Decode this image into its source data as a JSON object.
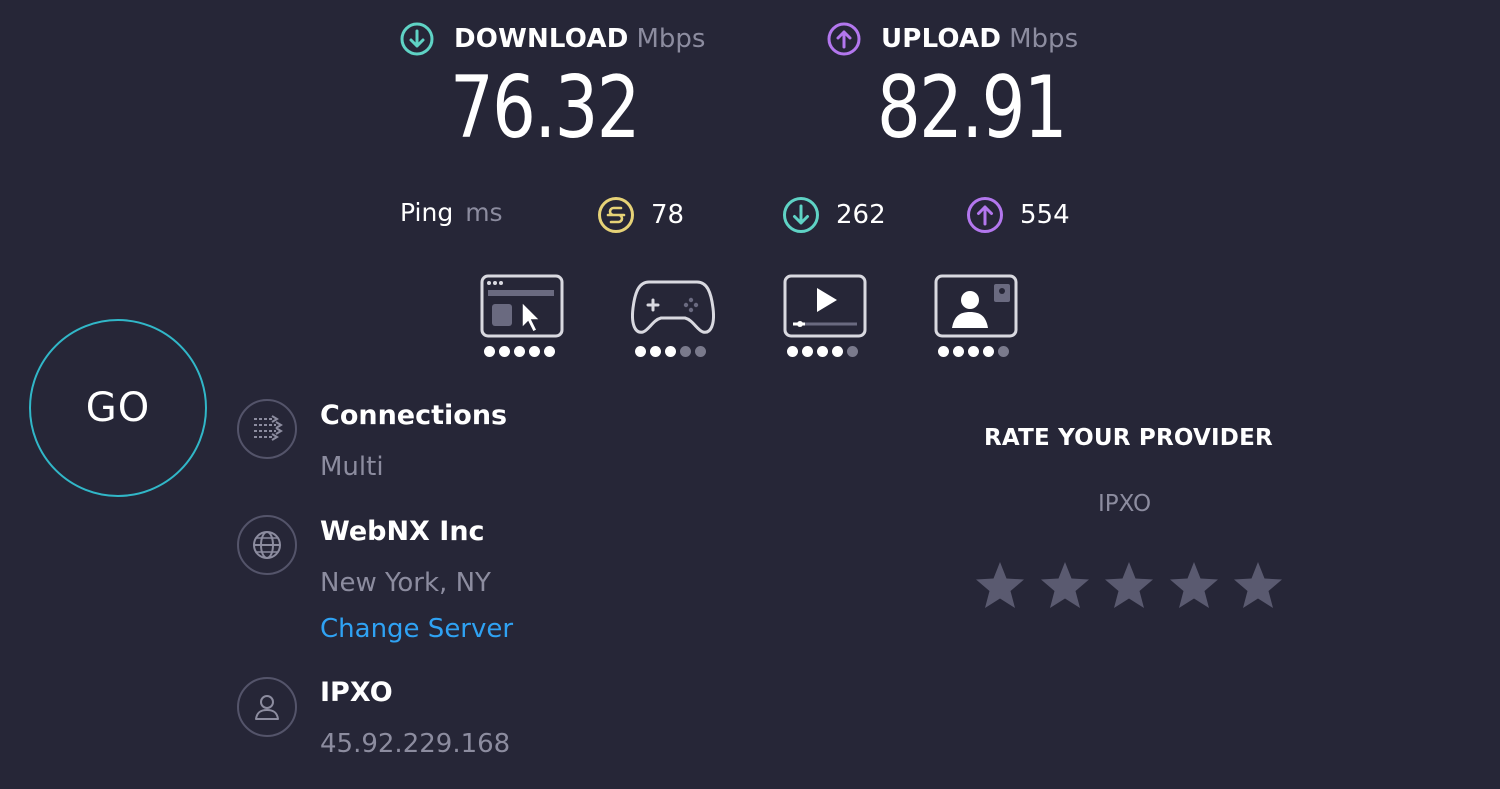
{
  "results": {
    "download": {
      "label": "DOWNLOAD",
      "unit": "Mbps",
      "value": "76.32",
      "color": "#5fd3c5",
      "icon": "download-arrow-icon"
    },
    "upload": {
      "label": "UPLOAD",
      "unit": "Mbps",
      "value": "82.91",
      "color": "#b377ee",
      "icon": "upload-arrow-icon"
    }
  },
  "ping": {
    "label": "Ping",
    "unit": "ms",
    "idle": {
      "value": "78",
      "color": "#e6d277",
      "icon": "idle-latency-icon"
    },
    "download": {
      "value": "262",
      "color": "#5fd3c5",
      "icon": "download-latency-icon"
    },
    "upload": {
      "value": "554",
      "color": "#b377ee",
      "icon": "upload-latency-icon"
    }
  },
  "experience": {
    "dot_scale": 5,
    "items": [
      {
        "name": "browsing",
        "icon": "web-browsing-icon",
        "rating": 5
      },
      {
        "name": "gaming",
        "icon": "gamepad-icon",
        "rating": 3
      },
      {
        "name": "streaming",
        "icon": "video-streaming-icon",
        "rating": 4
      },
      {
        "name": "video-chat",
        "icon": "video-chat-icon",
        "rating": 4
      }
    ]
  },
  "go_button": {
    "label": "GO",
    "color": "#31b7c8"
  },
  "connections": {
    "title": "Connections",
    "value": "Multi",
    "icon": "connections-icon"
  },
  "server": {
    "title": "WebNX Inc",
    "location": "New York, NY",
    "change_label": "Change Server",
    "icon": "globe-icon",
    "link_color": "#2fa2f3"
  },
  "provider": {
    "title": "IPXO",
    "ip": "45.92.229.168",
    "icon": "user-icon"
  },
  "rate": {
    "title": "RATE YOUR PROVIDER",
    "provider": "IPXO",
    "stars_total": 5,
    "stars_selected": 0,
    "star_color": "#5a5a70"
  }
}
